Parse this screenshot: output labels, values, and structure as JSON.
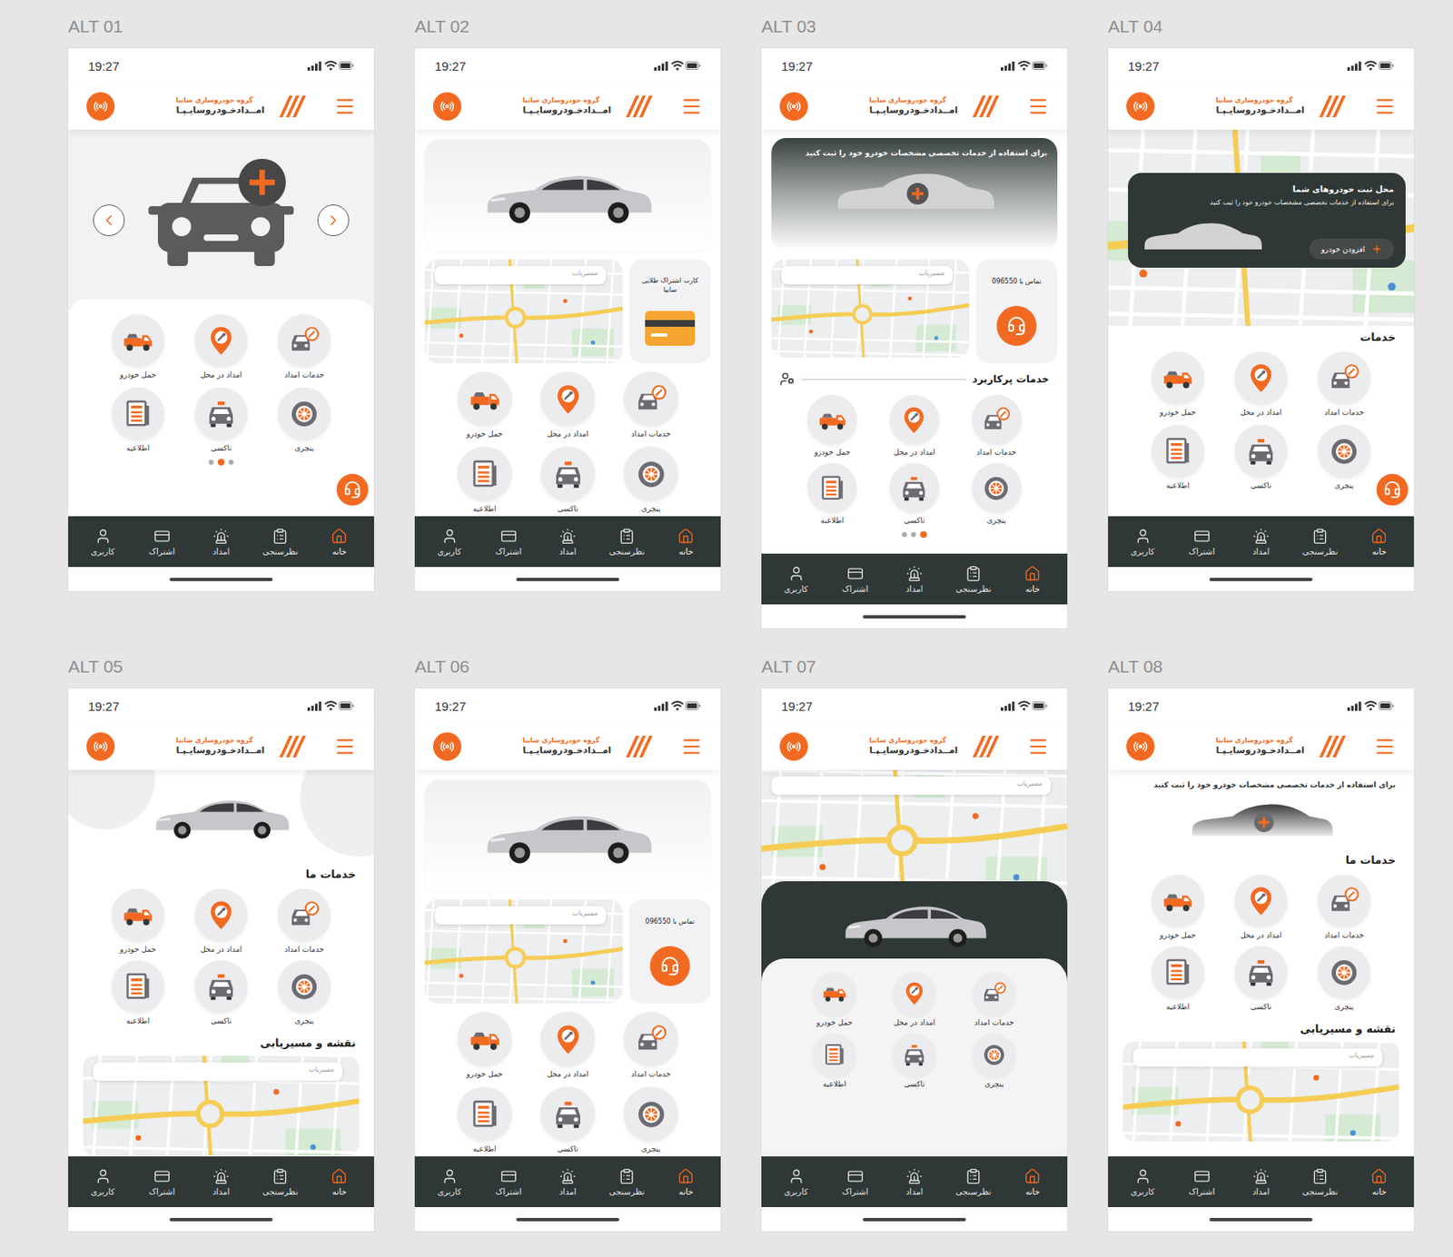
{
  "app": {
    "time": "19:27",
    "brand_small": "گروه خودروسازی سایپا",
    "brand": "امــدادخـودروسایـپـا"
  },
  "nav": [
    {
      "label": "کاربری",
      "selected": false
    },
    {
      "label": "اشتراک",
      "selected": false
    },
    {
      "label": "امداد",
      "selected": false
    },
    {
      "label": "نظرسنجی",
      "selected": false
    },
    {
      "label": "خانه",
      "selected": true
    }
  ],
  "services": [
    "حمل خودرو",
    "امداد در محل",
    "خدمات امداد",
    "اطلاعیه",
    "تاکسی",
    "پنچری"
  ],
  "search_placeholder": "مسیریاب",
  "alts": [
    {
      "label": "ALT 01",
      "kind": "carousel",
      "fab": true,
      "dots": [
        {
          "selected": false
        },
        {
          "selected": true
        },
        {
          "selected": false
        }
      ]
    },
    {
      "label": "ALT 02",
      "kind": "photo-map-card",
      "fab": false,
      "card_title": "کارت اشتراک طلایی سایپا"
    },
    {
      "label": "ALT 03",
      "kind": "register-map-contact",
      "fab": false,
      "register_text": "برای استفاده از خدمات تخصصی مشخصات خودرو خود را ثبت کنید",
      "contact": "تماس با 096550",
      "section": "خدمات پرکاربرد",
      "dots": [
        {
          "selected": false
        },
        {
          "selected": false
        },
        {
          "selected": true
        }
      ]
    },
    {
      "label": "ALT 04",
      "kind": "map-register",
      "fab": true,
      "title": "محل ثبت خودروهای شما",
      "register_text": "برای استفاده از خدمات تخصصی مشخصات خودرو خود را ثبت کنید",
      "button": "افزودن خودرو",
      "section": "خدمات"
    },
    {
      "label": "ALT 05",
      "kind": "photo-services-map",
      "fab": false,
      "section": "خدمات ما",
      "map_section": "نقشه و مسیریابی"
    },
    {
      "label": "ALT 06",
      "kind": "photo-map-contact",
      "fab": false,
      "contact": "تماس با 096550"
    },
    {
      "label": "ALT 07",
      "kind": "map-dark-photo",
      "fab": false
    },
    {
      "label": "ALT 08",
      "kind": "register-services-map",
      "fab": false,
      "register_text": "برای استفاده از خدمات تخصصی مشخصات خودرو خود را ثبت کنید",
      "section": "خدمات ما",
      "map_section": "نقشه و مسیریابی"
    }
  ]
}
